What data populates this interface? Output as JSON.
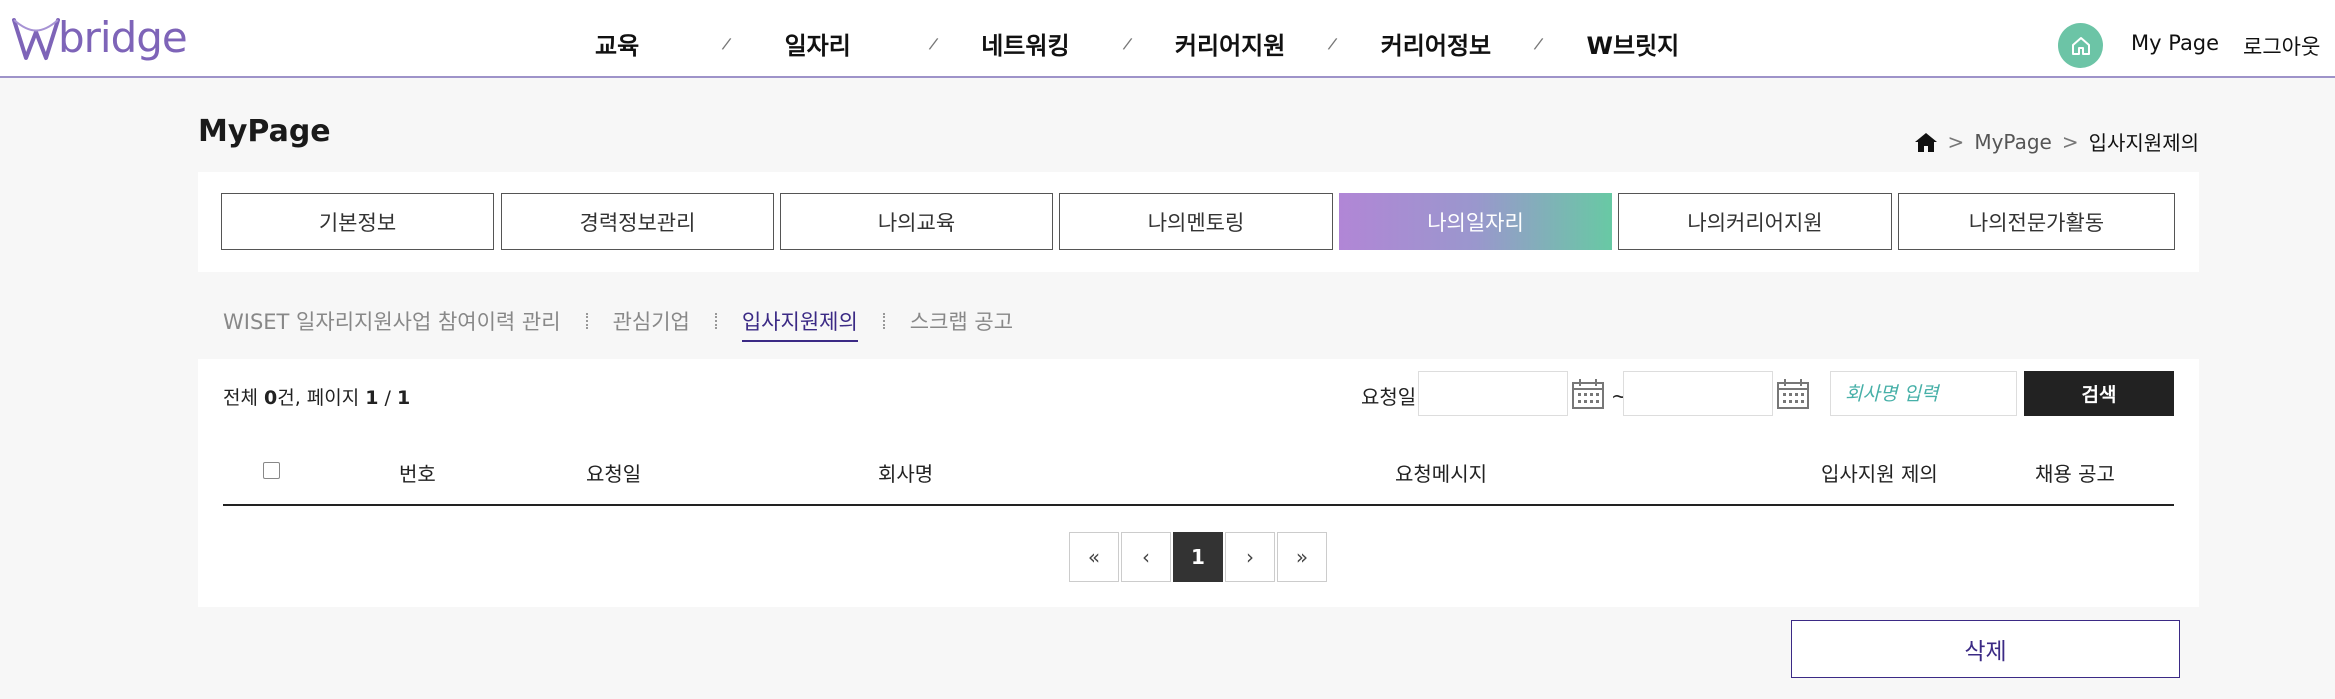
{
  "header": {
    "logo_text": "bridge",
    "nav": [
      "교육",
      "일자리",
      "네트워킹",
      "커리어지원",
      "커리어정보",
      "W브릿지"
    ],
    "mypage_label": "My Page",
    "logout_label": "로그아웃",
    "brand_color": "#7e64b8",
    "home_color": "#6cc4a6"
  },
  "page": {
    "title": "MyPage",
    "breadcrumb": [
      "MyPage",
      "입사지원제의"
    ]
  },
  "tabs": [
    "기본정보",
    "경력정보관리",
    "나의교육",
    "나의멘토링",
    "나의일자리",
    "나의커리어지원",
    "나의전문가활동"
  ],
  "active_tab": "나의일자리",
  "sub_tabs": [
    "WISET 일자리지원사업 참여이력 관리",
    "관심기업",
    "입사지원제의",
    "스크랩 공고"
  ],
  "active_sub_tab": "입사지원제의",
  "summary": {
    "prefix": "전체 ",
    "count": "0",
    "mid": "건, 페이지 ",
    "page": "1",
    "slash": " / ",
    "total_pages": "1"
  },
  "filter": {
    "date_label": "요청일",
    "date_from": "",
    "date_to": "",
    "tilde": "~",
    "company_placeholder": "회사명 입력",
    "search_label": "검색"
  },
  "table": {
    "columns": [
      "번호",
      "요청일",
      "회사명",
      "요청메시지",
      "입사지원 제의",
      "채용 공고"
    ],
    "rows": []
  },
  "pagination": {
    "first": "«",
    "prev": "‹",
    "current": "1",
    "next": "›",
    "last": "»"
  },
  "delete_label": "삭제"
}
